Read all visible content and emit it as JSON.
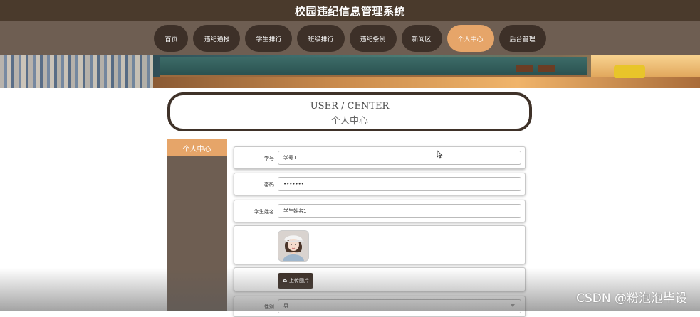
{
  "header": {
    "title": "校园违纪信息管理系统"
  },
  "nav": {
    "items": [
      {
        "label": "首页",
        "active": false
      },
      {
        "label": "违纪通报",
        "active": false
      },
      {
        "label": "学生排行",
        "active": false
      },
      {
        "label": "班级排行",
        "active": false
      },
      {
        "label": "违纪条例",
        "active": false
      },
      {
        "label": "新闻区",
        "active": false
      },
      {
        "label": "个人中心",
        "active": true
      },
      {
        "label": "后台管理",
        "active": false
      }
    ]
  },
  "page_title": {
    "en": "USER / CENTER",
    "cn": "个人中心"
  },
  "sidebar": {
    "items": [
      {
        "label": "个人中心"
      }
    ]
  },
  "form": {
    "student_id": {
      "label": "学号",
      "value": "学号1"
    },
    "password": {
      "label": "密码",
      "value": "•••••••"
    },
    "student_name": {
      "label": "学生姓名",
      "value": "学生姓名1"
    },
    "upload": {
      "label": "上传图片",
      "icon": "upload-cloud-icon"
    },
    "gender": {
      "label": "性别",
      "value": "男"
    }
  },
  "watermark": "CSDN @粉泡泡毕设",
  "colors": {
    "topbar": "#4a3a2c",
    "navbar": "#6e5e52",
    "nav_button": "#3d3028",
    "accent": "#e6a569"
  }
}
